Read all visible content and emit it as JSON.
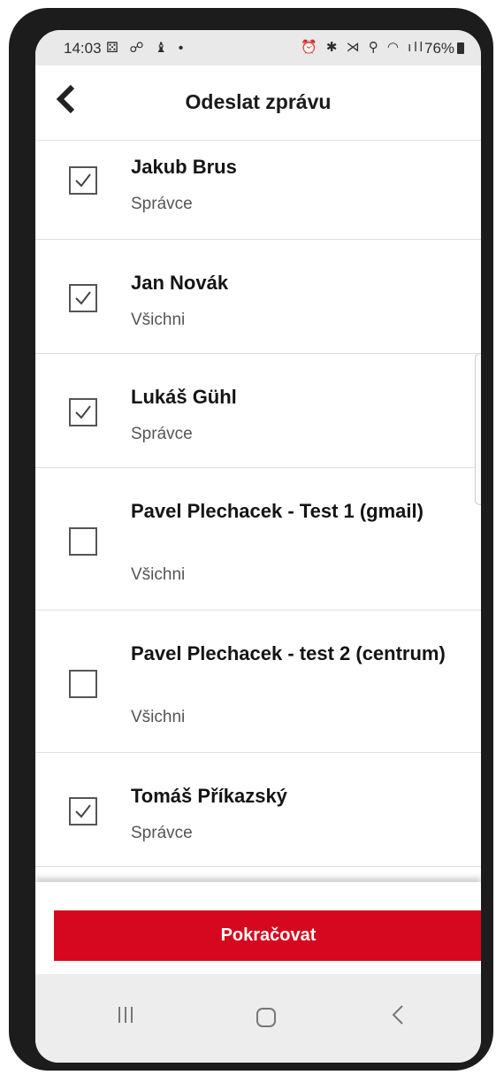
{
  "status_bar": {
    "time": "14:03",
    "left_icons": "⚄ ☍ ♝ •",
    "right_icons": "⏰ ✱ ⋊ ⚲ ◠ ıll",
    "battery": "76%"
  },
  "header": {
    "title": "Odeslat zprávu"
  },
  "recipients": [
    {
      "name": "Jakub Brus",
      "role": "Správce",
      "checked": true
    },
    {
      "name": "Jan Novák",
      "role": "Všichni",
      "checked": true
    },
    {
      "name": "Lukáš Gühl",
      "role": "Správce",
      "checked": true
    },
    {
      "name": "Pavel Plechacek - Test 1 (gmail)",
      "role": "Všichni",
      "checked": false
    },
    {
      "name": "Pavel Plechacek - test 2 (centrum)",
      "role": "Všichni",
      "checked": false
    },
    {
      "name": "Tomáš Příkazský",
      "role": "Správce",
      "checked": true
    }
  ],
  "footer": {
    "continue_label": "Pokračovat"
  },
  "colors": {
    "accent": "#d5081f"
  }
}
